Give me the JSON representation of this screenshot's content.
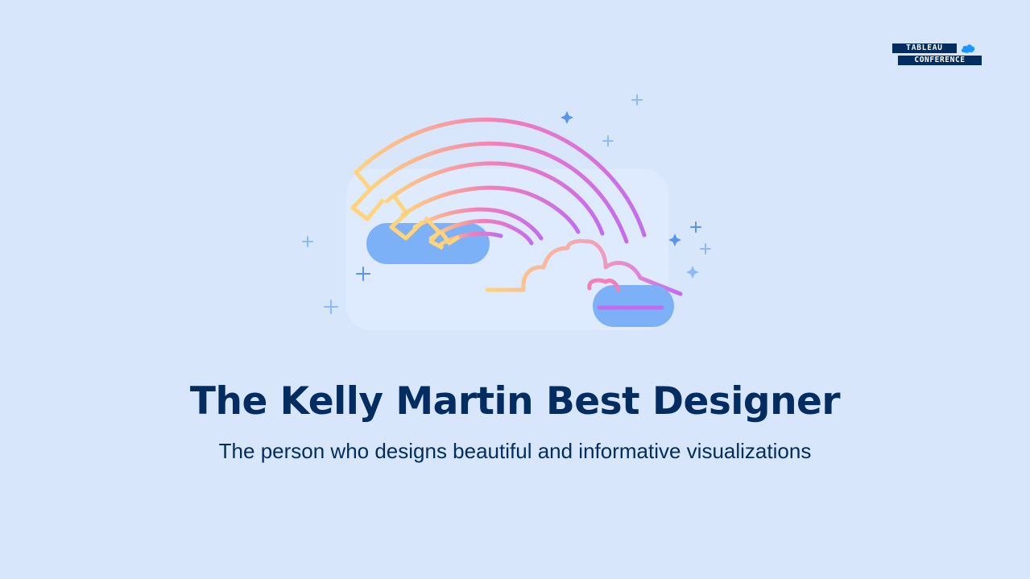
{
  "logo": {
    "line1": "TABLEAU",
    "line2": "CONFERENCE",
    "icon": "salesforce-cloud-icon"
  },
  "illustration": {
    "icon": "rainbow-clouds-icon"
  },
  "award": {
    "title": "The Kelly Martin Best Designer",
    "description": "The person who designs beautiful and informative visualizations"
  },
  "colors": {
    "background": "#d8e6fc",
    "text": "#032d60",
    "cloud": "#7db1f7",
    "sparkle": "#5a94ec",
    "rainbow_yellow": "#ffd37a",
    "rainbow_pink": "#f27fb8",
    "rainbow_purple": "#c46cf0"
  }
}
